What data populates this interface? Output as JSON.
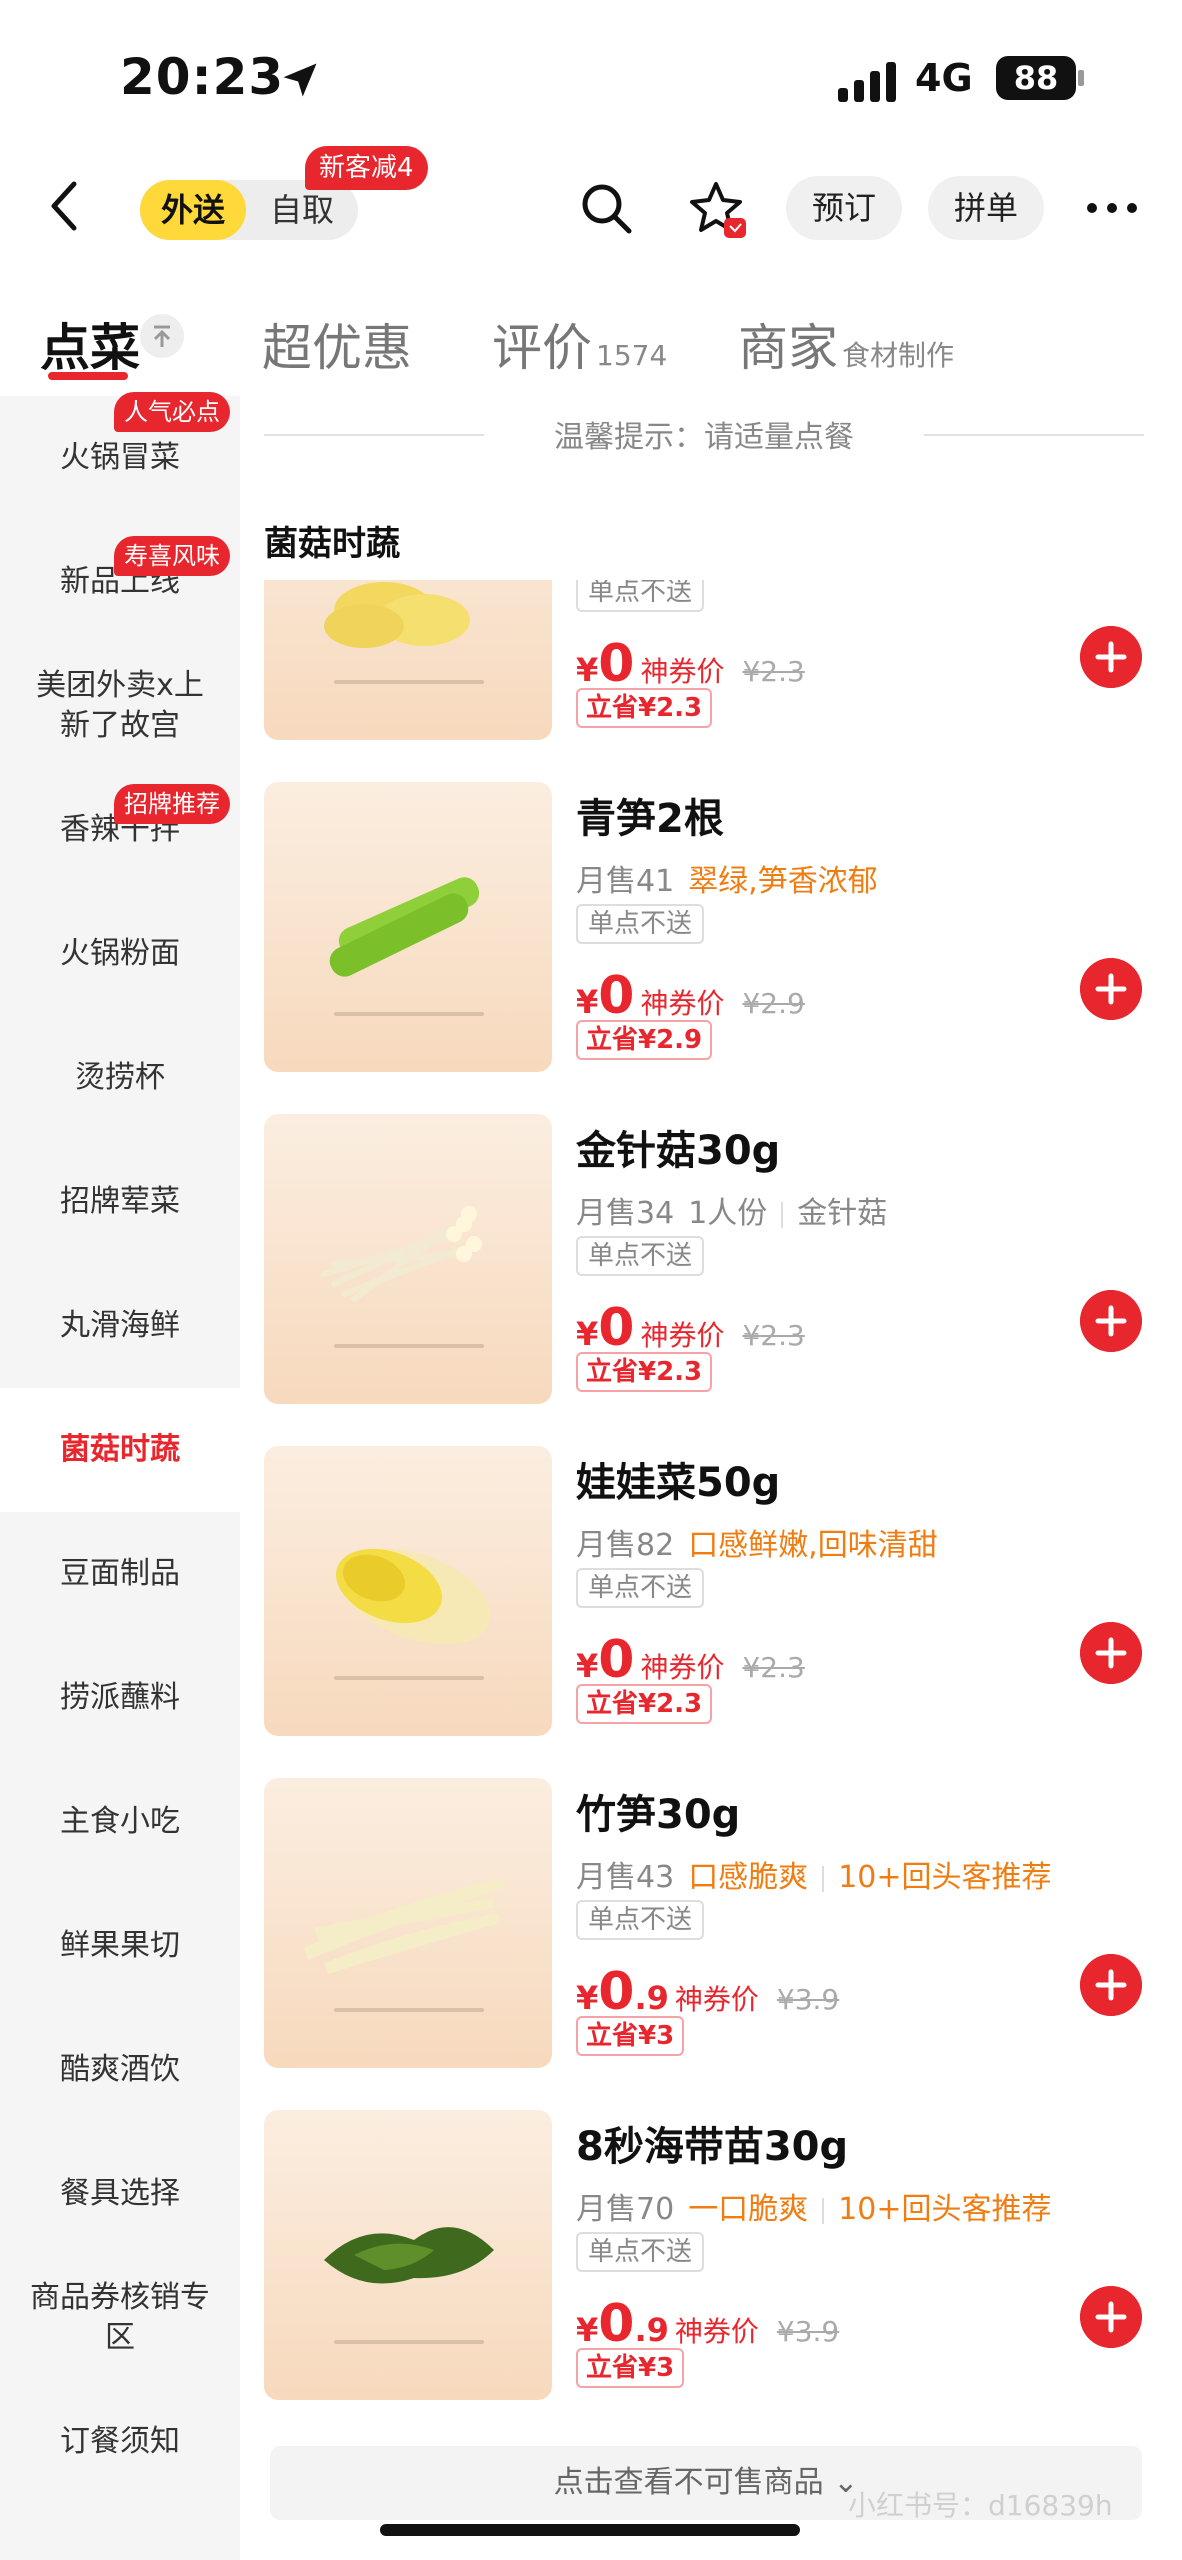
{
  "status_bar": {
    "time": "20:23",
    "network": "4G",
    "battery": "88"
  },
  "header": {
    "mode_delivery": "外送",
    "mode_pickup": "自取",
    "new_customer_badge": "新客减4",
    "reserve": "预订",
    "group_order": "拼单"
  },
  "tabs": {
    "order": "点菜",
    "deals": "超优惠",
    "reviews": "评价",
    "reviews_count": "1574",
    "merchant": "商家",
    "merchant_sub": "食材制作"
  },
  "sidebar": {
    "items": [
      {
        "label": "火锅冒菜",
        "tag": "人气必点"
      },
      {
        "label": "新品上线",
        "tag": "寿喜风味"
      },
      {
        "label": "美团外卖x上新了故宫",
        "tag": ""
      },
      {
        "label": "香辣干拌",
        "tag": "招牌推荐"
      },
      {
        "label": "火锅粉面",
        "tag": ""
      },
      {
        "label": "烫捞杯",
        "tag": ""
      },
      {
        "label": "招牌荤菜",
        "tag": ""
      },
      {
        "label": "丸滑海鲜",
        "tag": ""
      },
      {
        "label": "菌菇时蔬",
        "tag": ""
      },
      {
        "label": "豆面制品",
        "tag": ""
      },
      {
        "label": "捞派蘸料",
        "tag": ""
      },
      {
        "label": "主食小吃",
        "tag": ""
      },
      {
        "label": "鲜果果切",
        "tag": ""
      },
      {
        "label": "酷爽酒饮",
        "tag": ""
      },
      {
        "label": "餐具选择",
        "tag": ""
      },
      {
        "label": "商品券核销专区",
        "tag": ""
      },
      {
        "label": "订餐须知",
        "tag": ""
      }
    ],
    "active_index": 8
  },
  "main": {
    "hint": "温馨提示：请适量点餐",
    "section_title": "菌菇时蔬",
    "partial_item": {
      "tag": "单点不送",
      "price_int": "0",
      "price_label": "神券价",
      "orig_price": "¥2.3",
      "save": "立省¥2.3"
    },
    "items": [
      {
        "name": "青笋2根",
        "sales": "月售41",
        "highlights": [
          "翠绿,笋香浓郁"
        ],
        "tag": "单点不送",
        "price_int": "0",
        "price_dec": "",
        "price_label": "神券价",
        "orig_price": "¥2.9",
        "save": "立省¥2.9",
        "image": "celtuce"
      },
      {
        "name": "金针菇30g",
        "sales": "月售34",
        "details": [
          "1人份",
          "金针菇"
        ],
        "tag": "单点不送",
        "price_int": "0",
        "price_dec": "",
        "price_label": "神券价",
        "orig_price": "¥2.3",
        "save": "立省¥2.3",
        "image": "enoki"
      },
      {
        "name": "娃娃菜50g",
        "sales": "月售82",
        "highlights": [
          "口感鲜嫩,回味清甜"
        ],
        "tag": "单点不送",
        "price_int": "0",
        "price_dec": "",
        "price_label": "神券价",
        "orig_price": "¥2.3",
        "save": "立省¥2.3",
        "image": "baby-cabbage"
      },
      {
        "name": "竹笋30g",
        "sales": "月售43",
        "highlights": [
          "口感脆爽",
          "10+回头客推荐"
        ],
        "tag": "单点不送",
        "price_int": "0",
        "price_dec": ".9",
        "price_label": "神券价",
        "orig_price": "¥3.9",
        "save": "立省¥3",
        "image": "bamboo-shoot"
      },
      {
        "name": "8秒海带苗30g",
        "sales": "月售70",
        "highlights": [
          "一口脆爽",
          "10+回头客推荐"
        ],
        "tag": "单点不送",
        "price_int": "0",
        "price_dec": ".9",
        "price_label": "神券价",
        "orig_price": "¥3.9",
        "save": "立省¥3",
        "image": "kelp"
      }
    ],
    "currency": "¥",
    "unavailable_link": "点击查看不可售商品",
    "watermark": "小红书号：d16839h"
  },
  "colors": {
    "accent": "#e8262e",
    "highlight": "#ef7d12",
    "mode_active": "#ffd83a"
  }
}
